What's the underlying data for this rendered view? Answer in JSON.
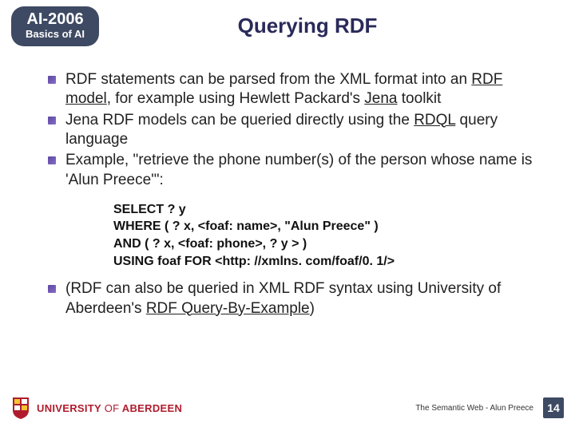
{
  "badge": {
    "title": "AI-2006",
    "sub": "Basics of AI"
  },
  "title": "Querying RDF",
  "bullets": {
    "b1_pre": "RDF statements can be parsed from the XML format into an ",
    "b1_u1": "RDF model",
    "b1_mid": ", for example using Hewlett Packard's ",
    "b1_u2": "Jena",
    "b1_post": " toolkit",
    "b2_pre": "Jena RDF models can be queried directly using the ",
    "b2_u1": "RDQL",
    "b2_post": " query language",
    "b3": "Example, \"retrieve the phone number(s) of the person whose name is 'Alun Preece'\":",
    "b4_pre": "(RDF can also be queried in XML RDF syntax using University of Aberdeen's ",
    "b4_u1": "RDF Query-By-Example",
    "b4_post": ")"
  },
  "code": {
    "l1": "SELECT ? y",
    "l2": "WHERE ( ? x, <foaf: name>, \"Alun Preece\" )",
    "l3": "AND ( ? x, <foaf: phone>, ? y > )",
    "l4": "USING foaf FOR <http: //xmlns. com/foaf/0. 1/>"
  },
  "footer": {
    "uni_prefix": "UNIVERSITY ",
    "uni_of": "OF",
    "uni_name": " ABERDEEN",
    "caption": "The Semantic Web - Alun Preece",
    "page": "14"
  }
}
